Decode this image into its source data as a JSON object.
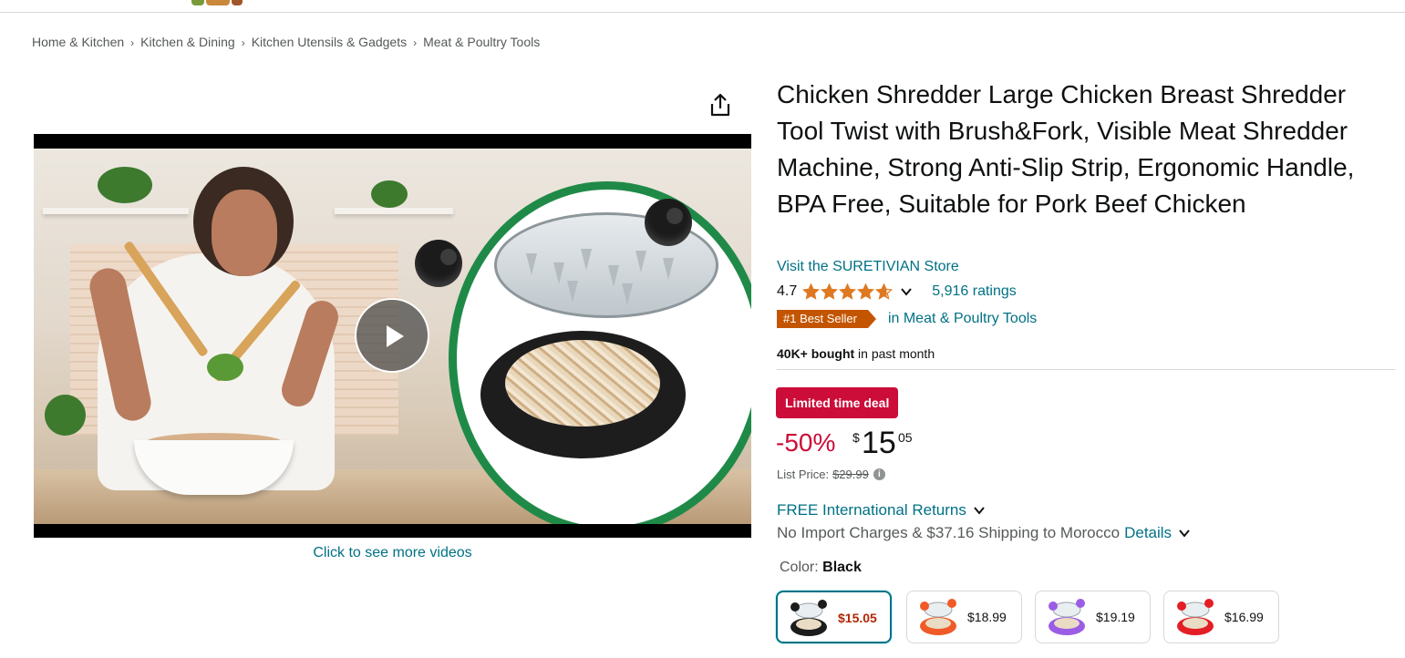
{
  "breadcrumb": {
    "items": [
      "Home & Kitchen",
      "Kitchen & Dining",
      "Kitchen Utensils & Gadgets",
      "Meat & Poultry Tools"
    ],
    "separator": "›"
  },
  "media": {
    "more_videos_label": "Click to see more videos",
    "icons": {
      "share": "share-icon",
      "play": "play-icon"
    }
  },
  "product": {
    "title": "Chicken Shredder Large Chicken Breast Shredder Tool Twist with Brush&Fork, Visible Meat Shredder Machine, Strong Anti-Slip Strip, Ergonomic Handle, BPA Free, Suitable for Pork Beef Chicken",
    "store_link": "Visit the SURETIVIAN Store",
    "rating": "4.7",
    "rating_value": 4.7,
    "ratings_count": "5,916 ratings",
    "best_seller_badge": "#1 Best Seller",
    "best_seller_category": "in Meat & Poultry Tools",
    "bought_bold": "40K+ bought",
    "bought_rest": " in past month"
  },
  "pricing": {
    "deal_badge": "Limited time deal",
    "discount": "-50%",
    "currency_symbol": "$",
    "price_whole": "15",
    "price_fraction": "05",
    "list_price_label": "List Price:",
    "list_price": "$29.99",
    "info_glyph": "i"
  },
  "delivery": {
    "returns": "FREE International Returns",
    "shipping_text": "No Import Charges & $37.16 Shipping to Morocco",
    "details_link": "Details"
  },
  "color": {
    "label": "Color:",
    "selected": "Black",
    "swatches": [
      {
        "price": "$15.05",
        "selected": true,
        "color": "#1c1c1c"
      },
      {
        "price": "$18.99",
        "selected": false,
        "color": "#f05a28"
      },
      {
        "price": "$19.19",
        "selected": false,
        "color": "#9b5de5"
      },
      {
        "price": "$16.99",
        "selected": false,
        "color": "#e31e24"
      }
    ]
  },
  "colors": {
    "link": "#007185",
    "deal_red": "#cc0c39",
    "best_seller": "#c45500",
    "star": "#de7921",
    "ring_green": "#1f8a48"
  }
}
